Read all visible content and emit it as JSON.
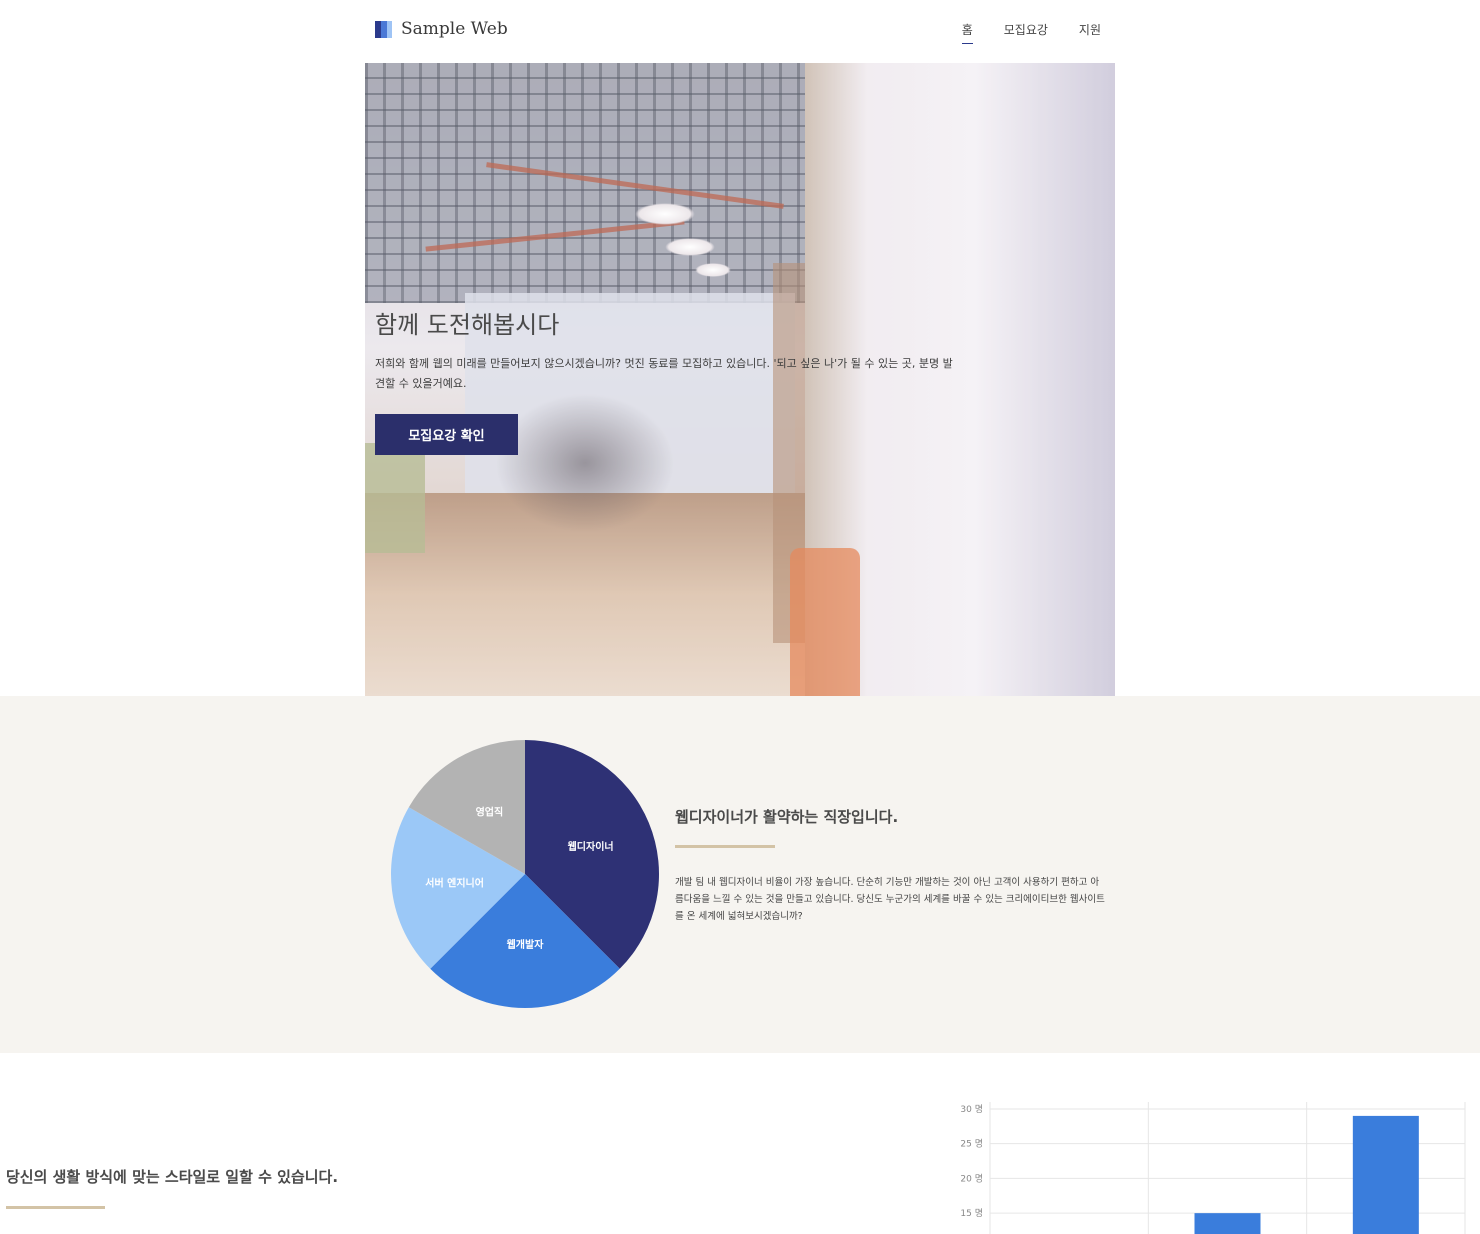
{
  "header": {
    "brand": "Sample Web",
    "nav": [
      {
        "label": "홈",
        "active": true
      },
      {
        "label": "모집요강",
        "active": false
      },
      {
        "label": "지원",
        "active": false
      }
    ]
  },
  "hero": {
    "title": "함께 도전해봅시다",
    "description": "저희와 함께 웹의 미래를 만들어보지 않으시겠습니까? 멋진 동료를 모집하고 있습니다. '되고 싶은 나'가 될 수 있는 곳, 분명 발견할 수 있을거예요.",
    "button_label": "모집요강 확인"
  },
  "section_roles": {
    "title": "웹디자이너가 활약하는 직장입니다.",
    "description": "개발 팀 내 웹디자이너 비율이 가장 높습니다. 단순히 기능만 개발하는 것이 아닌 고객이 사용하기 편하고 아름다움을 느낄 수 있는 것을 만들고 있습니다. 당신도 누군가의 세계를 바꿀 수 있는 크리에이티브한 웹사이트를 온 세계에 넓혀보시겠습니까?"
  },
  "section_style": {
    "title": "당신의 생활 방식에 맞는 스타일로 일할 수 있습니다."
  },
  "chart_data": [
    {
      "type": "pie",
      "categories": [
        "웹디자이너",
        "웹개발자",
        "서버 엔지니어",
        "영업직"
      ],
      "values": [
        37.5,
        25,
        20.8,
        16.7
      ],
      "colors": [
        "#2e3175",
        "#3a7ddc",
        "#9bc8f7",
        "#b3b3b3"
      ]
    },
    {
      "type": "bar",
      "categories": [
        "",
        "",
        ""
      ],
      "values": [
        null,
        15,
        29
      ],
      "y_tick_labels": [
        "30 명",
        "25 명",
        "20 명",
        "15 명"
      ],
      "y_ticks": [
        30,
        25,
        20,
        15
      ],
      "ylim": [
        12,
        31
      ],
      "colors": [
        "#3a7ddc"
      ]
    }
  ]
}
